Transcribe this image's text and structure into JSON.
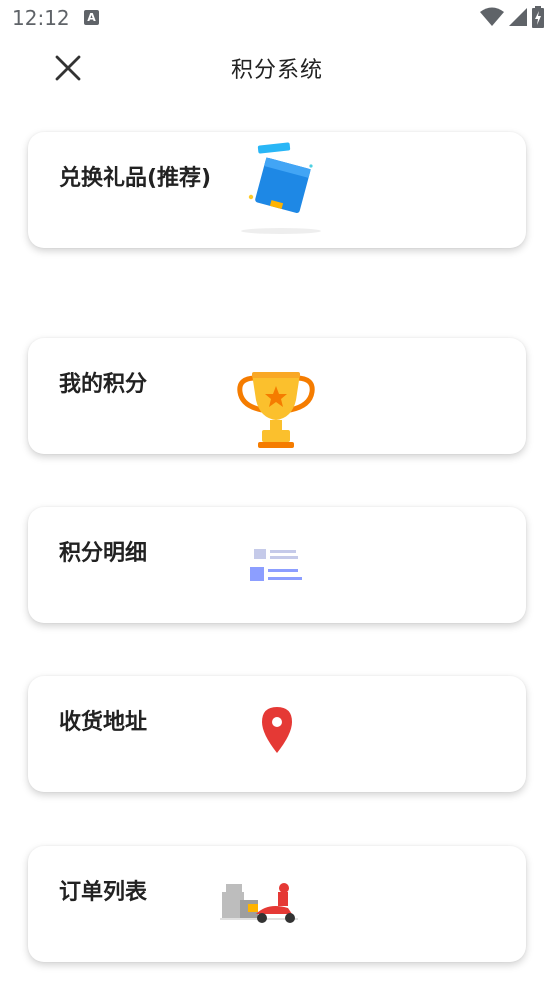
{
  "status_bar": {
    "time": "12:12",
    "notification_letter": "A"
  },
  "header": {
    "title": "积分系统"
  },
  "menu": [
    {
      "label": "兑换礼品(推荐)",
      "icon": "gift-box-icon"
    },
    {
      "label": "我的积分",
      "icon": "trophy-icon"
    },
    {
      "label": "积分明细",
      "icon": "list-detail-icon"
    },
    {
      "label": "收货地址",
      "icon": "location-pin-icon"
    },
    {
      "label": "订单列表",
      "icon": "delivery-scooter-icon"
    }
  ],
  "colors": {
    "gift_blue": "#1e88e5",
    "trophy_gold": "#fbc02d",
    "trophy_orange": "#f57c00",
    "list_blue": "#8c9eff",
    "pin_red": "#e53935",
    "scooter_red": "#e53935"
  }
}
